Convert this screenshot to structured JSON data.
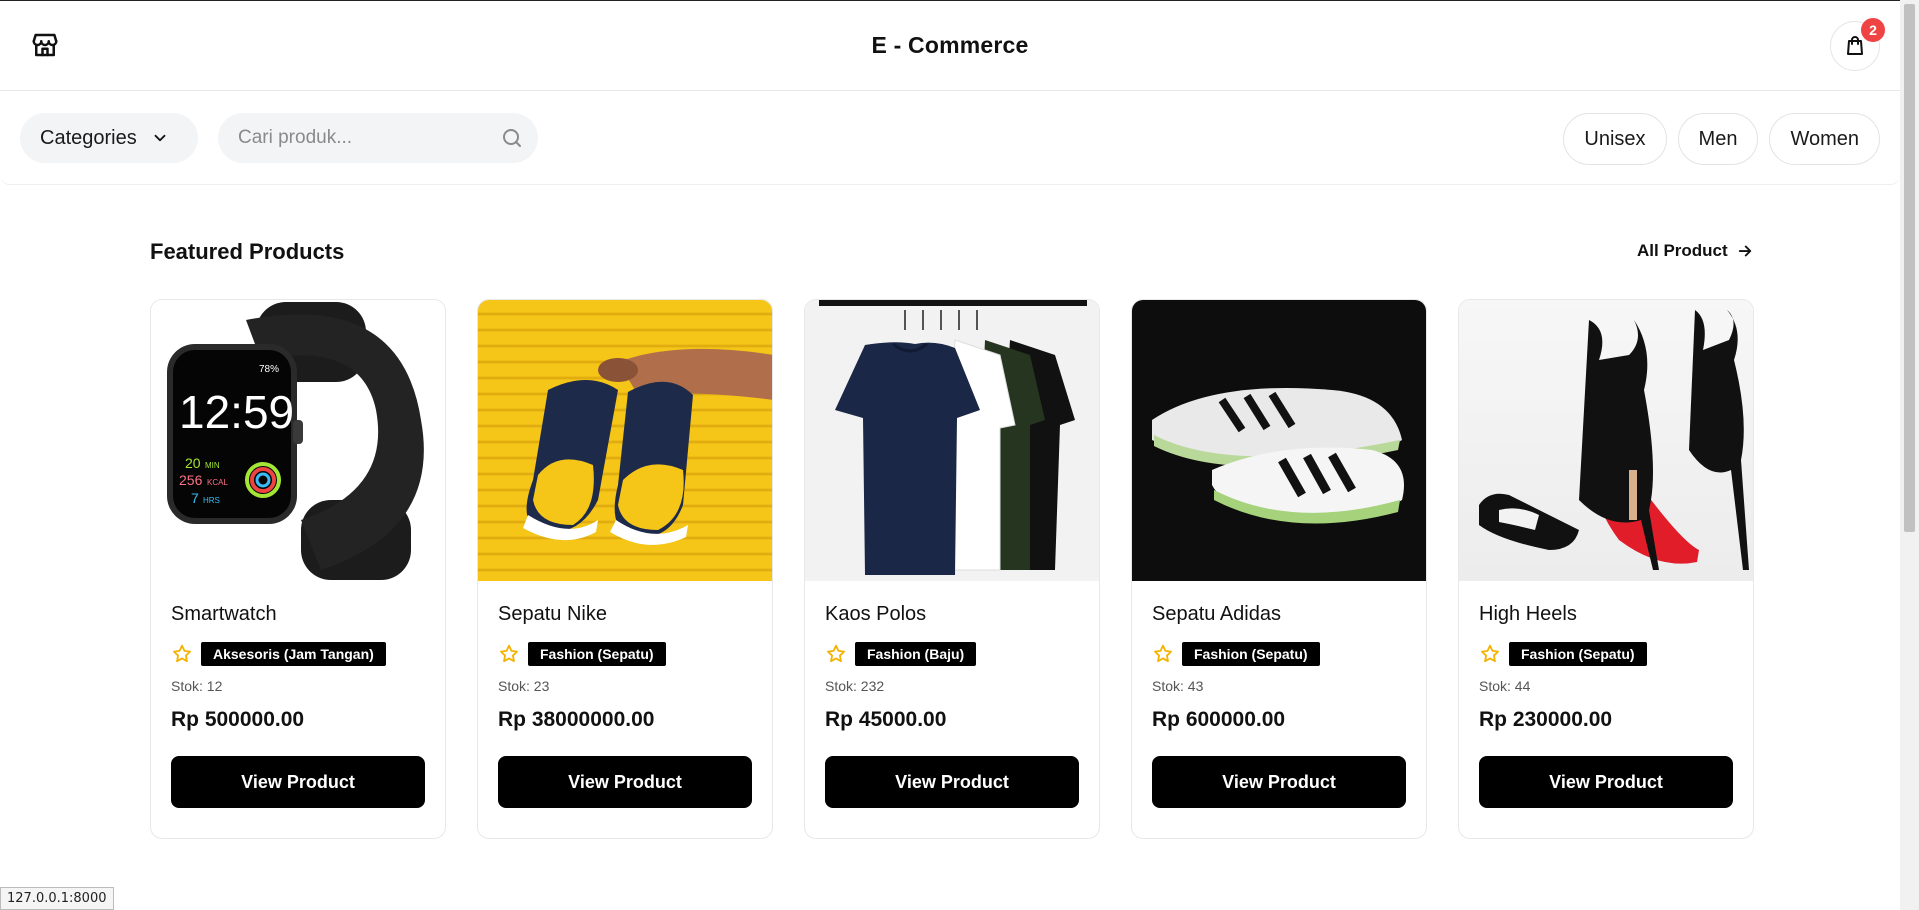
{
  "header": {
    "title": "E - Commerce",
    "cart_count": "2",
    "store_icon": "store-icon",
    "cart_icon": "shopping-bag-icon"
  },
  "filters": {
    "categories_label": "Categories",
    "search_placeholder": "Cari produk...",
    "genders": [
      "Unisex",
      "Men",
      "Women"
    ]
  },
  "featured": {
    "title": "Featured Products",
    "all_product_label": "All Product"
  },
  "products": [
    {
      "name": "Smartwatch",
      "category": "Aksesoris (Jam Tangan)",
      "stock": "Stok: 12",
      "price": "Rp 500000.00",
      "button": "View Product",
      "image": "smartwatch-image"
    },
    {
      "name": "Sepatu Nike",
      "category": "Fashion (Sepatu)",
      "stock": "Stok: 23",
      "price": "Rp 38000000.00",
      "button": "View Product",
      "image": "nike-sneakers-image"
    },
    {
      "name": "Kaos Polos",
      "category": "Fashion (Baju)",
      "stock": "Stok: 232",
      "price": "Rp 45000.00",
      "button": "View Product",
      "image": "tshirts-image"
    },
    {
      "name": "Sepatu Adidas",
      "category": "Fashion (Sepatu)",
      "stock": "Stok: 43",
      "price": "Rp 600000.00",
      "button": "View Product",
      "image": "adidas-sneakers-image"
    },
    {
      "name": "High Heels",
      "category": "Fashion (Sepatu)",
      "stock": "Stok: 44",
      "price": "Rp 230000.00",
      "button": "View Product",
      "image": "high-heels-image"
    }
  ],
  "smartwatch_screen": {
    "time": "12:59",
    "battery": "78%",
    "min": "20",
    "min_unit": "MIN",
    "kcal": "256",
    "kcal_unit": "KCAL",
    "hrs": "7",
    "hrs_unit": "HRS"
  },
  "status_bar": {
    "url": "127.0.0.1:8000"
  },
  "colors": {
    "accent": "#000000",
    "badge": "#ef4444",
    "star": "#f5b301"
  }
}
